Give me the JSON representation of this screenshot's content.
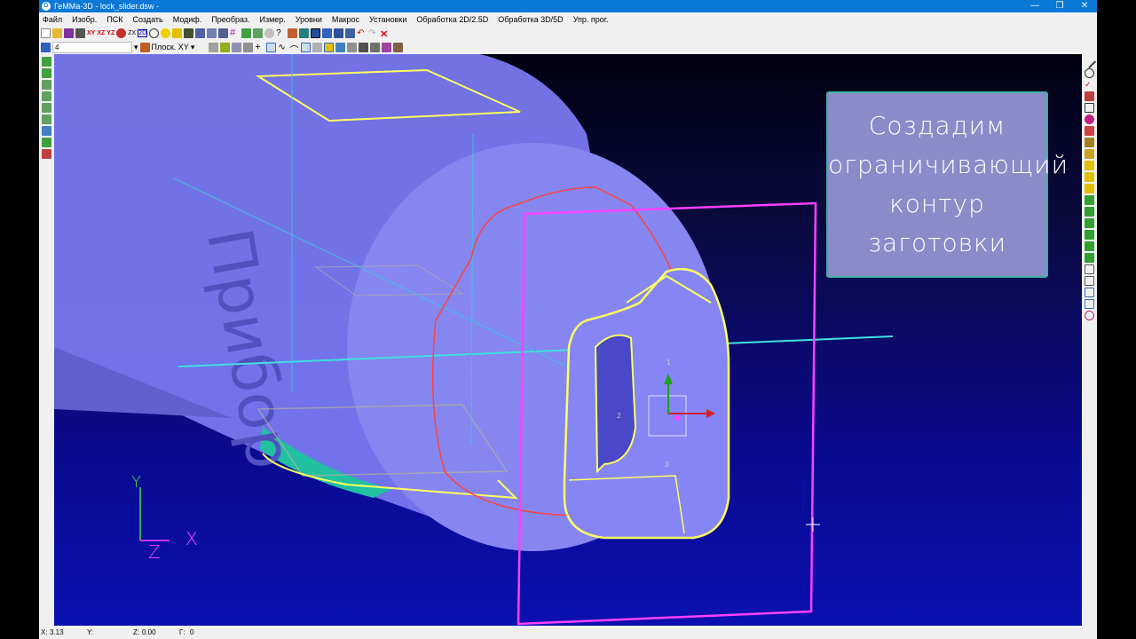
{
  "window": {
    "title": "ГеММа-3D - lock_slider.dsw -",
    "logo": "G",
    "minimize": "—",
    "restore": "❐",
    "close": "✕"
  },
  "menu": [
    "Файл",
    "Изобр.",
    "ПСК",
    "Создать",
    "Модиф.",
    "Преобраз.",
    "Измер.",
    "Уровни",
    "Макрос",
    "Установки",
    "Обработка 2D/2.5D",
    "Обработка 3D/5D",
    "Упр. прог."
  ],
  "toolbar1": {
    "labels": [
      "XY",
      "XZ",
      "YZ",
      "ZX",
      "2D"
    ]
  },
  "toolbar2": {
    "level": "4",
    "plane": "Плоск. XY"
  },
  "viewport": {
    "engraving": "Прибор",
    "axes": {
      "y": "Y",
      "x": "X",
      "z": "Z"
    },
    "triad": {
      "n1": "1",
      "n2": "2",
      "n3": "3"
    }
  },
  "note": {
    "lines": [
      "Создадим",
      "ограничивающий",
      "контур",
      "заготовки"
    ]
  },
  "status": {
    "x_label": "X:",
    "x_value": "3.13",
    "y_label": "Y:",
    "y_value": "",
    "z_label": "Z:",
    "z_value": "0.00",
    "g_label": "Г:",
    "g_value": "0"
  },
  "colors": {
    "titlebar": "#0a78d7",
    "note_bg": "#8b8bc9",
    "note_border": "#3fb0a8",
    "contour": "#ff40ff"
  }
}
